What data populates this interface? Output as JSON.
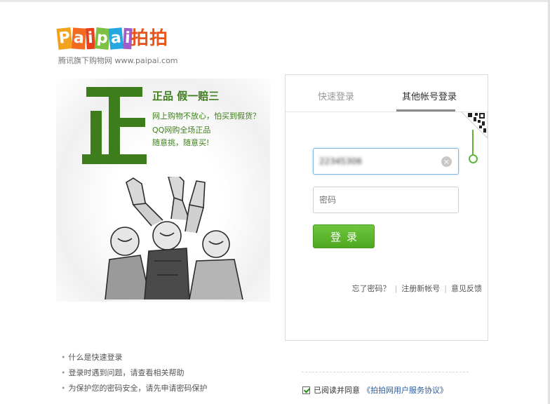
{
  "logo": {
    "letters": [
      "P",
      "a",
      "i",
      "p",
      "a",
      "i"
    ],
    "letter_colors": [
      "#f2a31b",
      "#f26b21",
      "#e8401c",
      "#7cc142",
      "#25a8e0",
      "#a05fc8"
    ],
    "brand_cn": "拍拍",
    "brand_color": "#e8541a",
    "subtitle": "腾讯旗下购物网 www.paipai.com"
  },
  "promo": {
    "big_char": "正",
    "title": "正品 假一赔三",
    "lines": [
      "网上购物不放心，怕买到假货？",
      "QQ网购全场正品",
      "随意挑，随意买!"
    ],
    "accent_color": "#3e7d1b"
  },
  "login": {
    "tabs": [
      {
        "label": "快速登录",
        "active": false
      },
      {
        "label": "其他帐号登录",
        "active": true
      }
    ],
    "qr_icon": "qr-code-icon",
    "username_value": "22345306",
    "password_placeholder": "密码",
    "clear_icon": "×",
    "submit_label": "登录",
    "submit_color": "#5cb82a",
    "links": {
      "forgot": "忘了密码？",
      "register": "注册新帐号",
      "feedback": "意见反馈",
      "separator": "|"
    }
  },
  "help": {
    "bullet": "•",
    "items": [
      "什么是快速登录",
      "登录时遇到问题，请查看相关帮助",
      "为保护您的密码安全，请先申请密码保护"
    ]
  },
  "agreement": {
    "checked": true,
    "text": "已阅读并同意",
    "link": "《拍拍网用户服务协议》"
  }
}
